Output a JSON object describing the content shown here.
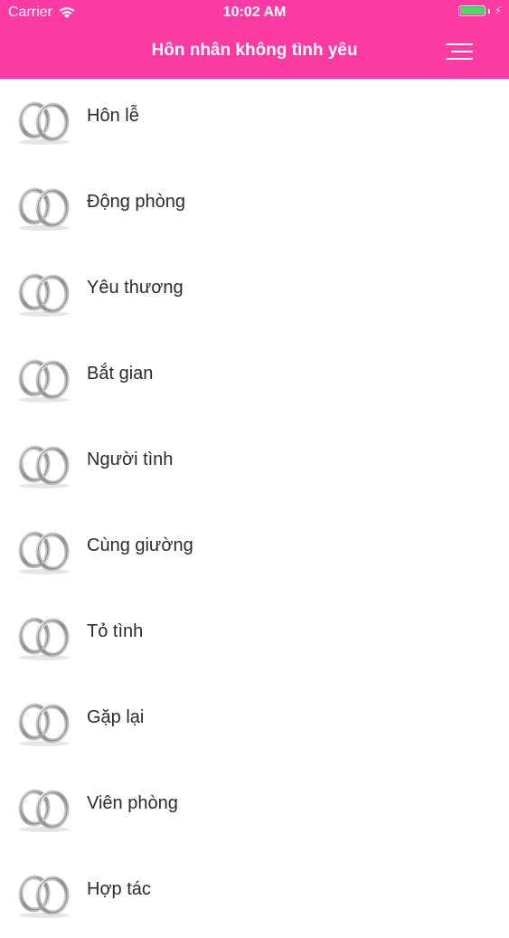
{
  "status_bar": {
    "carrier": "Carrier",
    "time": "10:02 AM",
    "battery_level": 1.0,
    "battery_color": "#4cd964"
  },
  "header": {
    "title": "Hôn nhân không tình yêu",
    "background_color": "#fb3ba3",
    "menu_icon": "hamburger-menu-icon"
  },
  "list": {
    "item_icon": "wedding-rings-icon",
    "items": [
      {
        "label": "Hôn lễ"
      },
      {
        "label": "Động phòng"
      },
      {
        "label": "Yêu thương"
      },
      {
        "label": "Bắt gian"
      },
      {
        "label": "Người tình"
      },
      {
        "label": "Cùng giường"
      },
      {
        "label": "Tỏ tình"
      },
      {
        "label": "Gặp lại"
      },
      {
        "label": "Viên phòng"
      },
      {
        "label": "Hợp tác"
      }
    ]
  }
}
